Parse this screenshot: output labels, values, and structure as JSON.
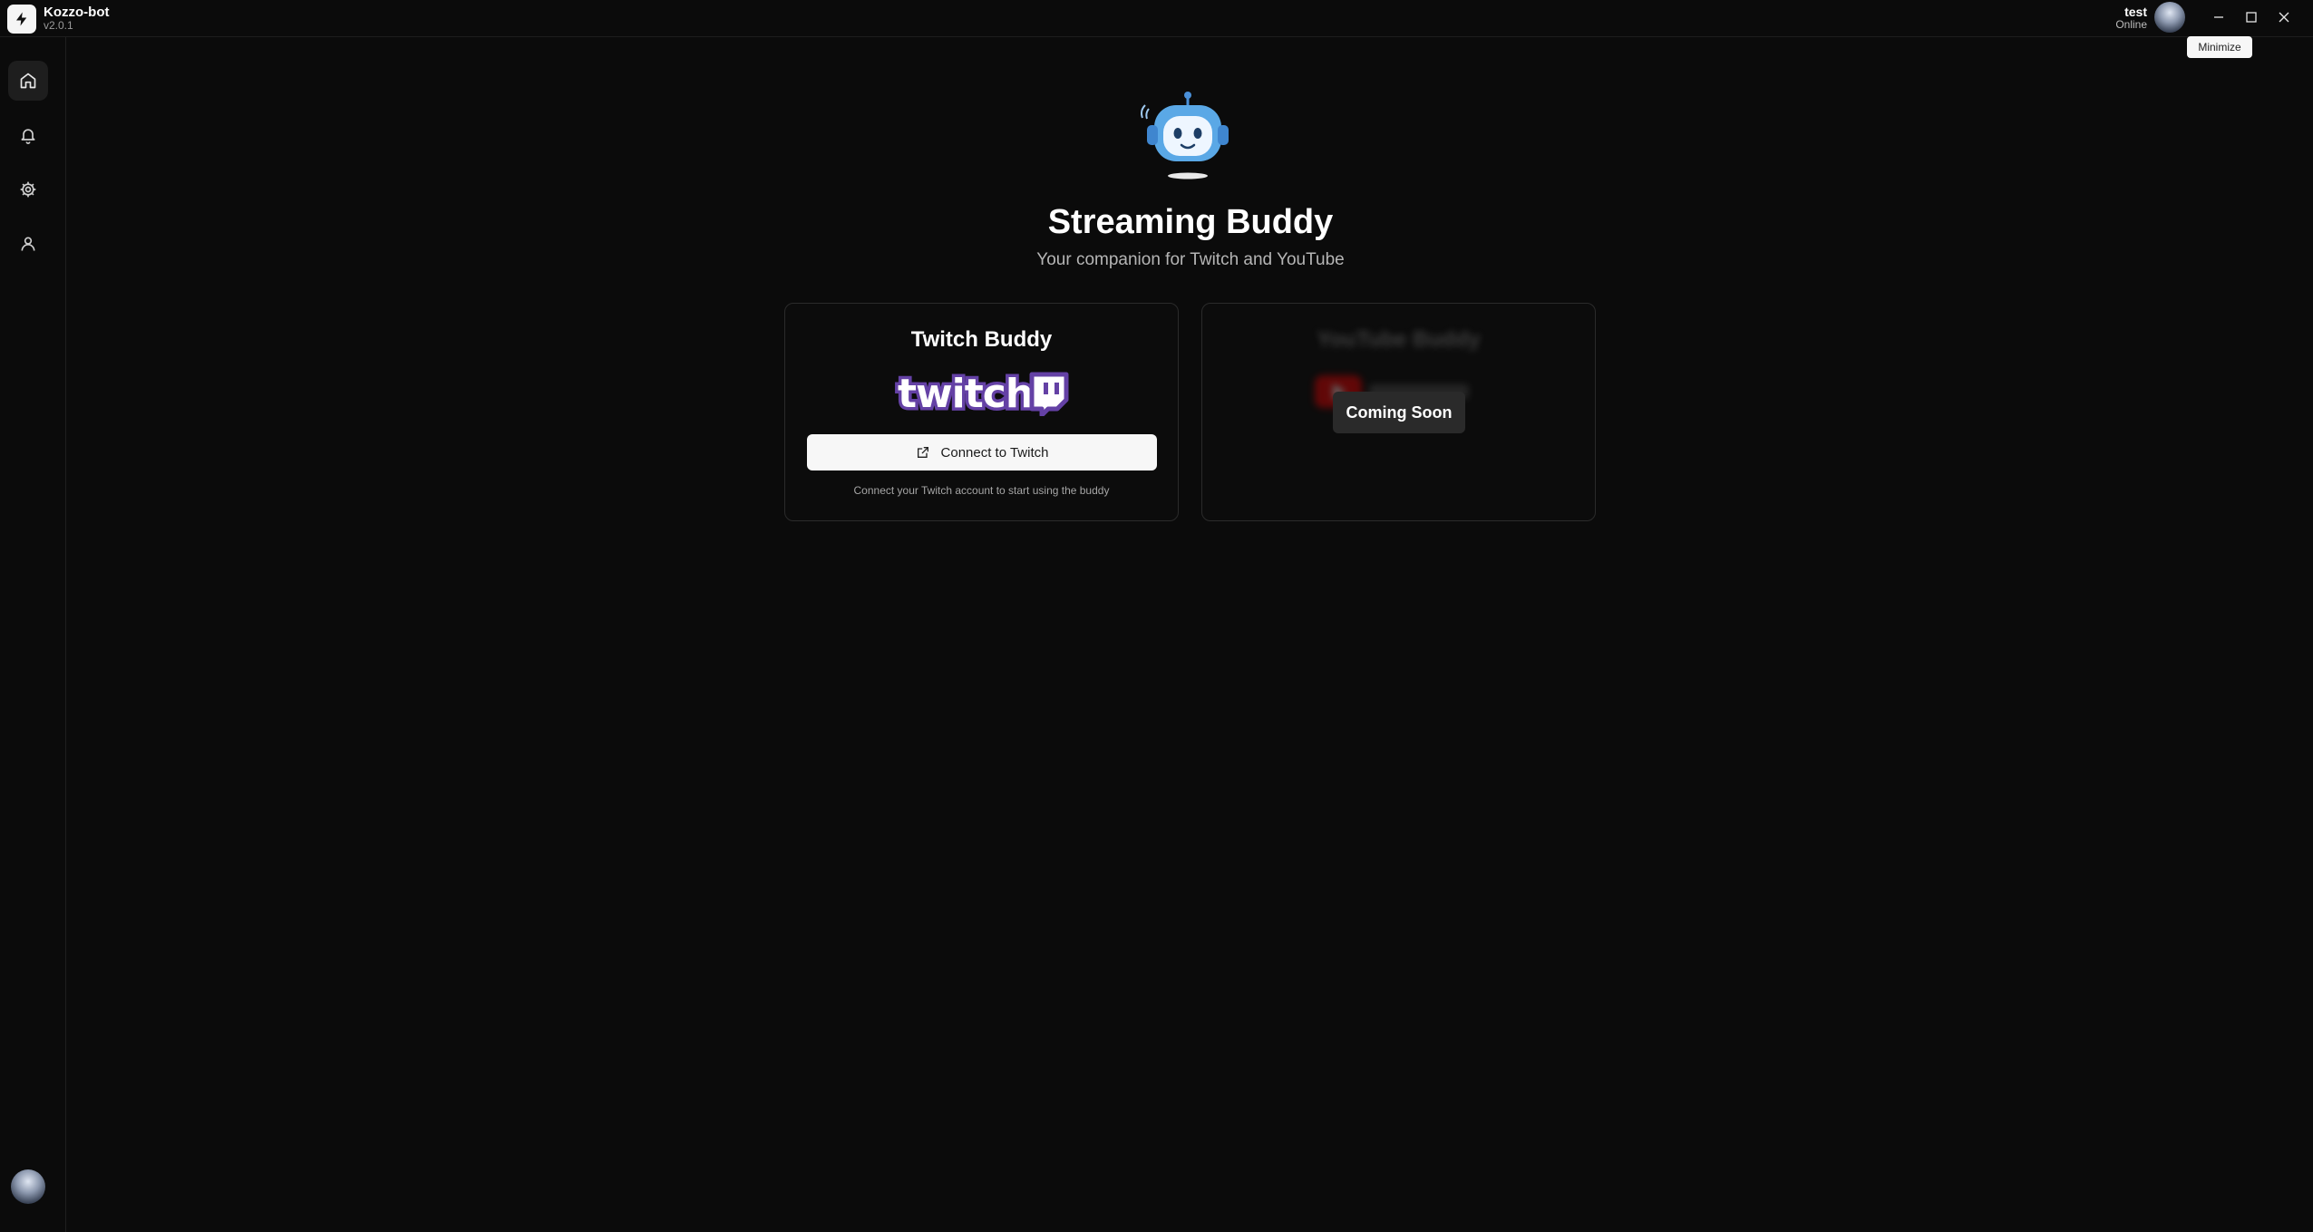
{
  "app": {
    "name": "Kozzo-bot",
    "version": "v2.0.1"
  },
  "user": {
    "name": "test",
    "status": "Online"
  },
  "window_controls": {
    "tooltip": "Minimize"
  },
  "sidebar": {
    "items": [
      {
        "name": "home",
        "icon": "home-icon",
        "active": true
      },
      {
        "name": "notifications",
        "icon": "bell-icon",
        "active": false
      },
      {
        "name": "settings",
        "icon": "gear-icon",
        "active": false
      },
      {
        "name": "profile",
        "icon": "user-icon",
        "active": false
      }
    ]
  },
  "main": {
    "title": "Streaming Buddy",
    "subtitle": "Your companion for Twitch and YouTube",
    "twitch_card": {
      "title": "Twitch Buddy",
      "logo_text": "twitch",
      "connect_label": "Connect to Twitch",
      "hint": "Connect your Twitch account to start using the buddy"
    },
    "youtube_card": {
      "title": "YouTube Buddy",
      "overlay_label": "Coming Soon"
    }
  },
  "colors": {
    "background": "#0b0b0b",
    "twitch_purple": "#6441a5",
    "youtube_red": "#ff0000",
    "robot_blue": "#5aa8e6"
  }
}
